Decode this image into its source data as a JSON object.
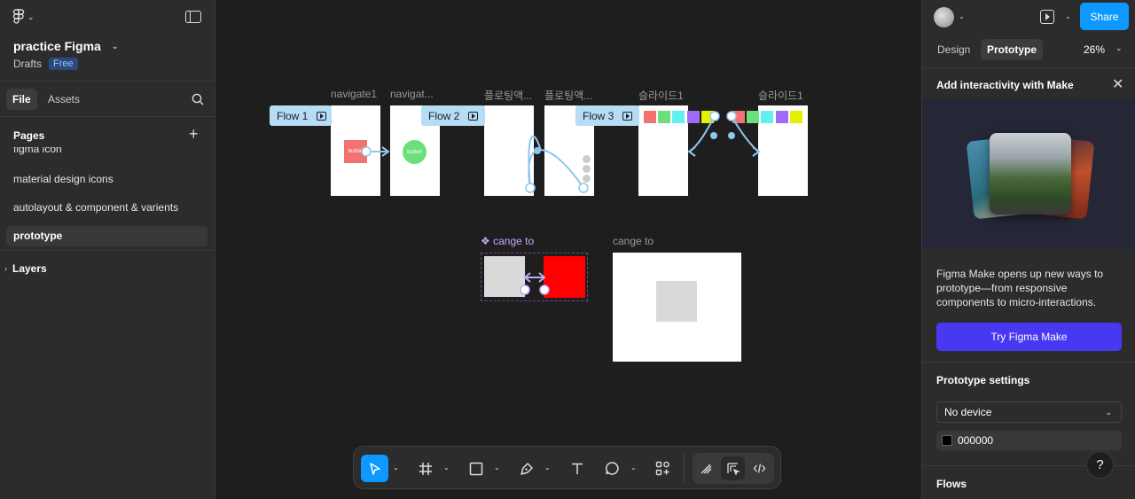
{
  "left_panel": {
    "project_title": "practice Figma",
    "location": "Drafts",
    "plan_badge": "Free",
    "tabs": [
      "File",
      "Assets"
    ],
    "pages_header": "Pages",
    "pages": [
      {
        "label": "figma icon",
        "active": false
      },
      {
        "label": "material design icons",
        "active": false
      },
      {
        "label": "autolayout & component & varients",
        "active": false
      },
      {
        "label": "prototype",
        "active": true
      }
    ],
    "layers_header": "Layers"
  },
  "canvas": {
    "frame_labels": [
      "navigate1",
      "navigat...",
      "플로팅액...",
      "플로팅액...",
      "슬라이드1",
      "슬라이드1"
    ],
    "flows": [
      "Flow 1",
      "Flow 2",
      "Flow 3"
    ],
    "button_label": "button",
    "component_label": "cange to",
    "frame_cange_label": "cange to",
    "slide_colors": [
      "#f47171",
      "#6be07a",
      "#5ff0ef",
      "#9e6cf8",
      "#e4f000"
    ]
  },
  "toolbar": {
    "tools": [
      "move-tool",
      "frame-tool",
      "shape-tool",
      "pen-tool",
      "text-tool",
      "comment-tool",
      "actions-tool"
    ]
  },
  "right_panel": {
    "share_label": "Share",
    "tabs": [
      "Design",
      "Prototype"
    ],
    "zoom": "26%",
    "make_header": "Add interactivity with Make",
    "make_description": "Figma Make opens up new ways to prototype—from responsive components to micro-interactions.",
    "make_button": "Try Figma Make",
    "prototype_settings_header": "Prototype settings",
    "device_value": "No device",
    "background_color": "000000",
    "help": "?",
    "flows_header": "Flows"
  }
}
